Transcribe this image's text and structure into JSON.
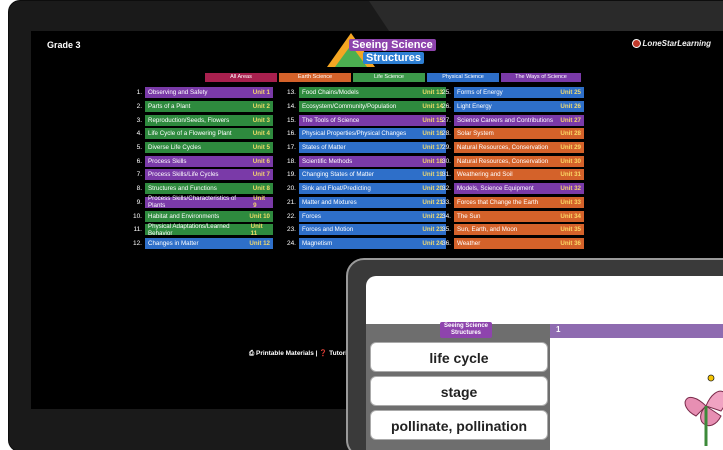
{
  "header": {
    "grade": "Grade 3",
    "brand": "LoneStarLearning",
    "logo_line1": "Seeing Science",
    "logo_line2": "Structures"
  },
  "categories": [
    {
      "label": "All Areas",
      "color": "#a8204e",
      "w": 72
    },
    {
      "label": "Earth Science",
      "color": "#d4622a",
      "w": 72
    },
    {
      "label": "Life Science",
      "color": "#3c9a4a",
      "w": 72
    },
    {
      "label": "Physical Science",
      "color": "#2e6fc9",
      "w": 72
    },
    {
      "label": "The Ways of Science",
      "color": "#7a3aa8",
      "w": 80
    }
  ],
  "units": [
    {
      "n": "1.",
      "t": "Observing and Safety",
      "u": "Unit 1",
      "c": "#7a3aa8"
    },
    {
      "n": "2.",
      "t": "Parts of a Plant",
      "u": "Unit 2",
      "c": "#2e8a3e"
    },
    {
      "n": "3.",
      "t": "Reproduction/Seeds, Flowers",
      "u": "Unit 3",
      "c": "#2e8a3e"
    },
    {
      "n": "4.",
      "t": "Life Cycle of a Flowering Plant",
      "u": "Unit 4",
      "c": "#2e8a3e"
    },
    {
      "n": "5.",
      "t": "Diverse Life Cycles",
      "u": "Unit 5",
      "c": "#2e8a3e"
    },
    {
      "n": "6.",
      "t": "Process Skills",
      "u": "Unit 6",
      "c": "#7a3aa8"
    },
    {
      "n": "7.",
      "t": "Process Skills/Life Cycles",
      "u": "Unit 7",
      "c": "#7a3aa8"
    },
    {
      "n": "8.",
      "t": "Structures and Functions",
      "u": "Unit 8",
      "c": "#2e8a3e"
    },
    {
      "n": "9.",
      "t": "Process Skills/Characteristics of Plants",
      "u": "Unit 9",
      "c": "#7a3aa8"
    },
    {
      "n": "10.",
      "t": "Habitat and Environments",
      "u": "Unit 10",
      "c": "#2e8a3e"
    },
    {
      "n": "11.",
      "t": "Physical Adaptations/Learned Behavior",
      "u": "Unit 11",
      "c": "#2e8a3e"
    },
    {
      "n": "12.",
      "t": "Changes in Matter",
      "u": "Unit 12",
      "c": "#2e6fc9"
    },
    {
      "n": "13.",
      "t": "Food Chains/Models",
      "u": "Unit 13",
      "c": "#2e8a3e"
    },
    {
      "n": "14.",
      "t": "Ecosystem/Community/Population",
      "u": "Unit 14",
      "c": "#2e8a3e"
    },
    {
      "n": "15.",
      "t": "The Tools of Science",
      "u": "Unit 15",
      "c": "#7a3aa8"
    },
    {
      "n": "16.",
      "t": "Physical Properties/Physical Changes",
      "u": "Unit 16",
      "c": "#2e6fc9"
    },
    {
      "n": "17.",
      "t": "States of Matter",
      "u": "Unit 17",
      "c": "#2e6fc9"
    },
    {
      "n": "18.",
      "t": "Scientific Methods",
      "u": "Unit 18",
      "c": "#7a3aa8"
    },
    {
      "n": "19.",
      "t": "Changing States of Matter",
      "u": "Unit 19",
      "c": "#2e6fc9"
    },
    {
      "n": "20.",
      "t": "Sink and Float/Predicting",
      "u": "Unit 20",
      "c": "#2e6fc9"
    },
    {
      "n": "21.",
      "t": "Matter and Mixtures",
      "u": "Unit 21",
      "c": "#2e6fc9"
    },
    {
      "n": "22.",
      "t": "Forces",
      "u": "Unit 22",
      "c": "#2e6fc9"
    },
    {
      "n": "23.",
      "t": "Forces and Motion",
      "u": "Unit 23",
      "c": "#2e6fc9"
    },
    {
      "n": "24.",
      "t": "Magnetism",
      "u": "Unit 24",
      "c": "#2e6fc9"
    },
    {
      "n": "25.",
      "t": "Forms of Energy",
      "u": "Unit 25",
      "c": "#2e6fc9"
    },
    {
      "n": "26.",
      "t": "Light Energy",
      "u": "Unit 26",
      "c": "#2e6fc9"
    },
    {
      "n": "27.",
      "t": "Science Careers and Contributions",
      "u": "Unit 27",
      "c": "#7a3aa8"
    },
    {
      "n": "28.",
      "t": "Solar System",
      "u": "Unit 28",
      "c": "#d4622a"
    },
    {
      "n": "29.",
      "t": "Natural Resources, Conservation",
      "u": "Unit 29",
      "c": "#d4622a"
    },
    {
      "n": "30.",
      "t": "Natural Resources, Conservation",
      "u": "Unit 30",
      "c": "#d4622a"
    },
    {
      "n": "31.",
      "t": "Weathering and Soil",
      "u": "Unit 31",
      "c": "#d4622a"
    },
    {
      "n": "32.",
      "t": "Models, Science Equipment",
      "u": "Unit 32",
      "c": "#7a3aa8"
    },
    {
      "n": "33.",
      "t": "Forces that Change the Earth",
      "u": "Unit 33",
      "c": "#d4622a"
    },
    {
      "n": "34.",
      "t": "The Sun",
      "u": "Unit 34",
      "c": "#d4622a"
    },
    {
      "n": "35.",
      "t": "Sun, Earth, and Moon",
      "u": "Unit 35",
      "c": "#d4622a"
    },
    {
      "n": "36.",
      "t": "Weather",
      "u": "Unit 36",
      "c": "#d4622a"
    }
  ],
  "footer": {
    "links": "⎙ Printable Materials | ❓ Tutorial | ©"
  },
  "tablet": {
    "logo_line1": "Seeing Science",
    "logo_line2": "Structures",
    "card_number": "1",
    "cards": [
      "life cycle",
      "stage",
      "pollinate, pollination"
    ]
  }
}
